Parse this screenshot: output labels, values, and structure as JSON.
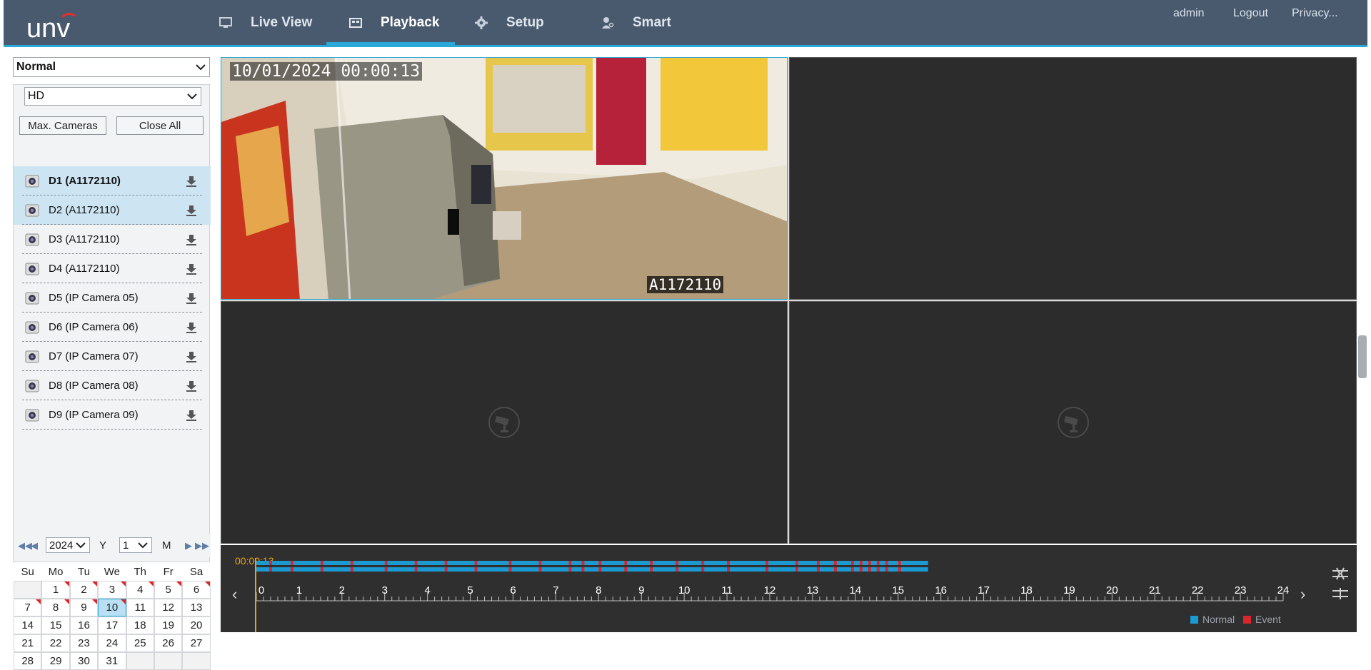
{
  "brand": {
    "logo_text": "unv",
    "accent": "#2aa8d8",
    "header_bg": "#4a5a6e"
  },
  "nav": [
    {
      "label": "Live View",
      "icon": "monitor-icon"
    },
    {
      "label": "Playback",
      "icon": "playback-icon",
      "active": true
    },
    {
      "label": "Setup",
      "icon": "gear-icon"
    },
    {
      "label": "Smart",
      "icon": "person-icon"
    }
  ],
  "user": {
    "name": "admin",
    "logout": "Logout",
    "privacy": "Privacy..."
  },
  "left": {
    "record_type": "Normal",
    "stream": "HD",
    "max_cameras": "Max. Cameras",
    "close_all": "Close All",
    "cameras": [
      {
        "label": "D1 (A1172110)",
        "selected": true
      },
      {
        "label": "D2 (A1172110)",
        "selected": true
      },
      {
        "label": "D3 (A1172110)"
      },
      {
        "label": "D4 (A1172110)"
      },
      {
        "label": "D5 (IP Camera 05)"
      },
      {
        "label": "D6 (IP Camera 06)"
      },
      {
        "label": "D7 (IP Camera 07)"
      },
      {
        "label": "D8 (IP Camera 08)"
      },
      {
        "label": "D9 (IP Camera 09)"
      }
    ]
  },
  "calendar": {
    "year": "2024",
    "year_unit": "Y",
    "month": "1",
    "month_unit": "M",
    "weekdays": [
      "Su",
      "Mo",
      "Tu",
      "We",
      "Th",
      "Fr",
      "Sa"
    ],
    "weeks": [
      [
        "",
        "1",
        "2",
        "3",
        "4",
        "5",
        "6"
      ],
      [
        "7",
        "8",
        "9",
        "10",
        "11",
        "12",
        "13"
      ],
      [
        "14",
        "15",
        "16",
        "17",
        "18",
        "19",
        "20"
      ],
      [
        "21",
        "22",
        "23",
        "24",
        "25",
        "26",
        "27"
      ],
      [
        "28",
        "29",
        "30",
        "31",
        "",
        "",
        ""
      ]
    ],
    "recorded_days": [
      "1",
      "2",
      "3",
      "4",
      "5",
      "6",
      "7",
      "8",
      "9",
      "10"
    ],
    "selected_day": "10"
  },
  "video": {
    "osd_timestamp": "10/01/2024 00:00:13",
    "osd_camera": "A1172110"
  },
  "timeline": {
    "current_time": "00:00:13",
    "hours": [
      "0",
      "1",
      "2",
      "3",
      "4",
      "5",
      "6",
      "7",
      "8",
      "9",
      "10",
      "11",
      "12",
      "13",
      "14",
      "15",
      "16",
      "17",
      "18",
      "19",
      "20",
      "21",
      "22",
      "23",
      "24"
    ],
    "recording_end_hour": 15.7,
    "event_hours": [
      0.3,
      0.8,
      1.5,
      2.2,
      3.0,
      3.7,
      4.4,
      5.1,
      5.9,
      6.6,
      7.3,
      7.6,
      8.0,
      8.6,
      9.2,
      9.8,
      10.4,
      11.0,
      11.9,
      12.6,
      13.1,
      13.5,
      13.9,
      14.1,
      14.3,
      14.5,
      14.7,
      15.0
    ],
    "legend_normal": "Normal",
    "legend_event": "Event",
    "normal_color": "#1b9ad2",
    "event_color": "#d8272c"
  }
}
